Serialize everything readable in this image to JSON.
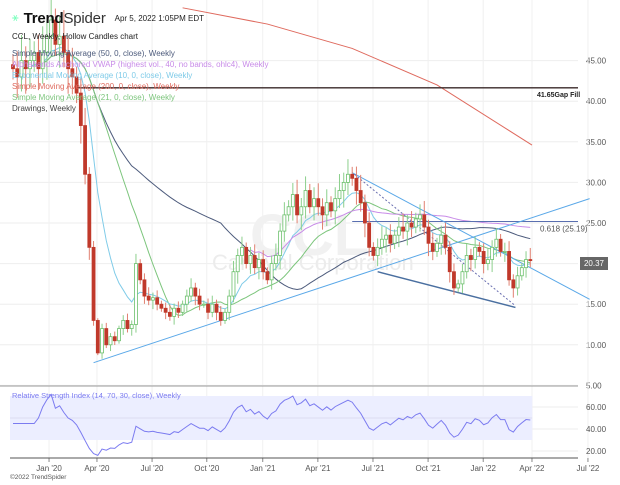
{
  "header": {
    "brand_bold": "Trend",
    "brand_light": "Spider",
    "timestamp": "Apr 5, 2022 1:05PM EDT",
    "chart_title": "CCL, Weekly, Hollow Candles chart"
  },
  "legend": [
    {
      "label": "Simple Moving Average (50, 0, close), Weekly",
      "color": "#4d5b7c"
    },
    {
      "label": "Alphabands Anchored VWAP (highest vol., 40, no bands, ohlc4), Weekly",
      "color": "#c88be8"
    },
    {
      "label": "Exponential Moving Average (10, 0, close), Weekly",
      "color": "#7fcbe8"
    },
    {
      "label": "Simple Moving Average (200, 0, close), Weekly",
      "color": "#df6a5e"
    },
    {
      "label": "Simple Moving Average (21, 0, close), Weekly",
      "color": "#7cc57c"
    },
    {
      "label": "Drawings, Weekly",
      "color": "#444444"
    }
  ],
  "watermark": {
    "ticker": "CCL",
    "name": "Carnival Corporation"
  },
  "last_price": "20.37",
  "copyright": "©2022 TrendSpider",
  "rsi_title": "Relative Strength Index (14, 70, 30, close), Weekly",
  "chart_data": {
    "type": "candlestick",
    "title": "CCL, Weekly, Hollow Candles chart",
    "y_ticks": [
      "5.00",
      "10.00",
      "15.00",
      "20.00",
      "25.00",
      "30.00",
      "35.00",
      "40.00",
      "45.00"
    ],
    "ylim": [
      5,
      45.5
    ],
    "x_ticks": [
      {
        "label": "Jan '20",
        "week": 8.5
      },
      {
        "label": "Apr '20",
        "week": 19.8
      },
      {
        "label": "Jul '20",
        "week": 32.8
      },
      {
        "label": "Oct '20",
        "week": 45.7
      },
      {
        "label": "Jan '21",
        "week": 58.9
      },
      {
        "label": "Apr '21",
        "week": 71.9
      },
      {
        "label": "Jul '21",
        "week": 84.9
      },
      {
        "label": "Oct '21",
        "week": 97.9
      },
      {
        "label": "Jan '22",
        "week": 110.9
      },
      {
        "label": "Apr '22",
        "week": 122.4
      },
      {
        "label": "Jul '22",
        "week": 135.6
      }
    ],
    "first_open": 44.5,
    "closes": [
      44,
      43,
      45,
      44,
      45,
      46,
      44,
      46,
      48,
      50,
      47,
      48,
      46,
      44,
      43,
      41,
      37,
      31,
      22,
      13,
      9,
      12,
      10,
      11,
      10.5,
      12,
      13,
      12,
      12.5,
      20,
      18,
      16,
      15.5,
      15.8,
      15,
      14.5,
      14,
      13.5,
      14.5,
      14,
      15,
      16,
      17,
      16,
      15,
      15,
      14,
      15,
      14,
      13,
      14,
      16,
      19,
      21,
      22,
      20,
      21,
      19.5,
      20.5,
      19,
      18,
      20,
      21,
      24,
      26,
      27,
      28.5,
      26,
      27,
      29,
      27,
      28,
      27,
      26,
      27.5,
      26.5,
      28,
      29,
      30,
      31,
      30.5,
      29,
      27.5,
      25,
      22,
      21,
      22,
      23,
      23.5,
      22.5,
      23.5,
      24.5,
      24,
      25,
      24.5,
      25.5,
      26,
      24.5,
      22.5,
      21.5,
      22.5,
      23.5,
      22,
      19,
      17,
      17.5,
      19,
      21,
      20.5,
      22,
      21.5,
      20,
      20.5,
      22,
      23,
      21.5,
      21.5,
      18,
      17,
      18.5,
      19.5,
      20.5,
      20.37
    ],
    "sma200_points": [
      [
        40,
        51.5
      ],
      [
        60,
        49.5
      ],
      [
        80,
        46.5
      ],
      [
        100,
        42
      ],
      [
        122.4,
        34.6
      ]
    ],
    "annotations": {
      "gap_fill": {
        "price": 41.65,
        "label": "41.65",
        "text": "Gap Fill",
        "from_week": 15
      },
      "fib": {
        "price": 25.19,
        "label": "0.618 (25.19)",
        "from_week": 80
      },
      "support_trendline": [
        [
          19,
          7.8
        ],
        [
          136,
          28
        ]
      ],
      "channel_upper": [
        [
          80,
          31.2
        ],
        [
          136,
          15.6
        ]
      ],
      "channel_lower": [
        [
          86,
          19
        ],
        [
          118.5,
          14.6
        ]
      ],
      "dashed_line": [
        [
          80.5,
          31
        ],
        [
          118.5,
          14.8
        ]
      ]
    },
    "rsi": {
      "ylim": [
        12,
        78
      ],
      "y_ticks": [
        "20.00",
        "40.00",
        "60.00"
      ],
      "band": [
        30,
        70
      ],
      "mid": 50
    }
  }
}
